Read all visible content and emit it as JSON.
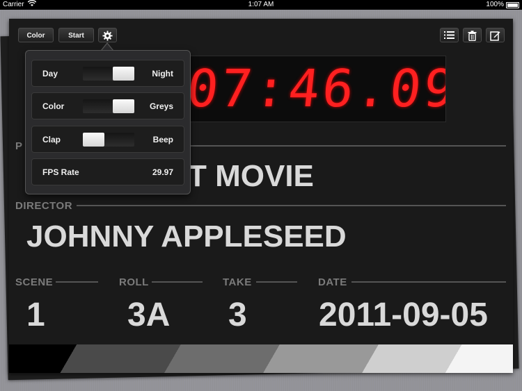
{
  "status_bar": {
    "carrier": "Carrier",
    "time": "1:07 AM",
    "battery": "100%"
  },
  "toolbar": {
    "color_label": "Color",
    "start_label": "Start"
  },
  "timecode": "07:46.09",
  "fields": {
    "production_label": "P",
    "production_value": "T MOVIE",
    "director_label": "DIRECTOR",
    "director_value": "JOHNNY APPLESEED",
    "scene_label": "SCENE",
    "scene_value": "1",
    "roll_label": "ROLL",
    "roll_value": "3A",
    "take_label": "TAKE",
    "take_value": "3",
    "date_label": "DATE",
    "date_value": "2011-09-05"
  },
  "settings": {
    "day_night": {
      "left": "Day",
      "right": "Night",
      "state": "right"
    },
    "color_greys": {
      "left": "Color",
      "right": "Greys",
      "state": "right"
    },
    "clap_beep": {
      "left": "Clap",
      "right": "Beep",
      "state": "left"
    },
    "fps_label": "FPS Rate",
    "fps_value": "29.97"
  },
  "icons": [
    "wifi-icon",
    "battery-icon",
    "gear-icon",
    "list-icon",
    "trash-icon",
    "edit-icon"
  ],
  "colors": {
    "timecode": "#ff2020",
    "board": "#1a1a1a",
    "text": "#d9d9d9",
    "label": "#7b7b7b"
  }
}
